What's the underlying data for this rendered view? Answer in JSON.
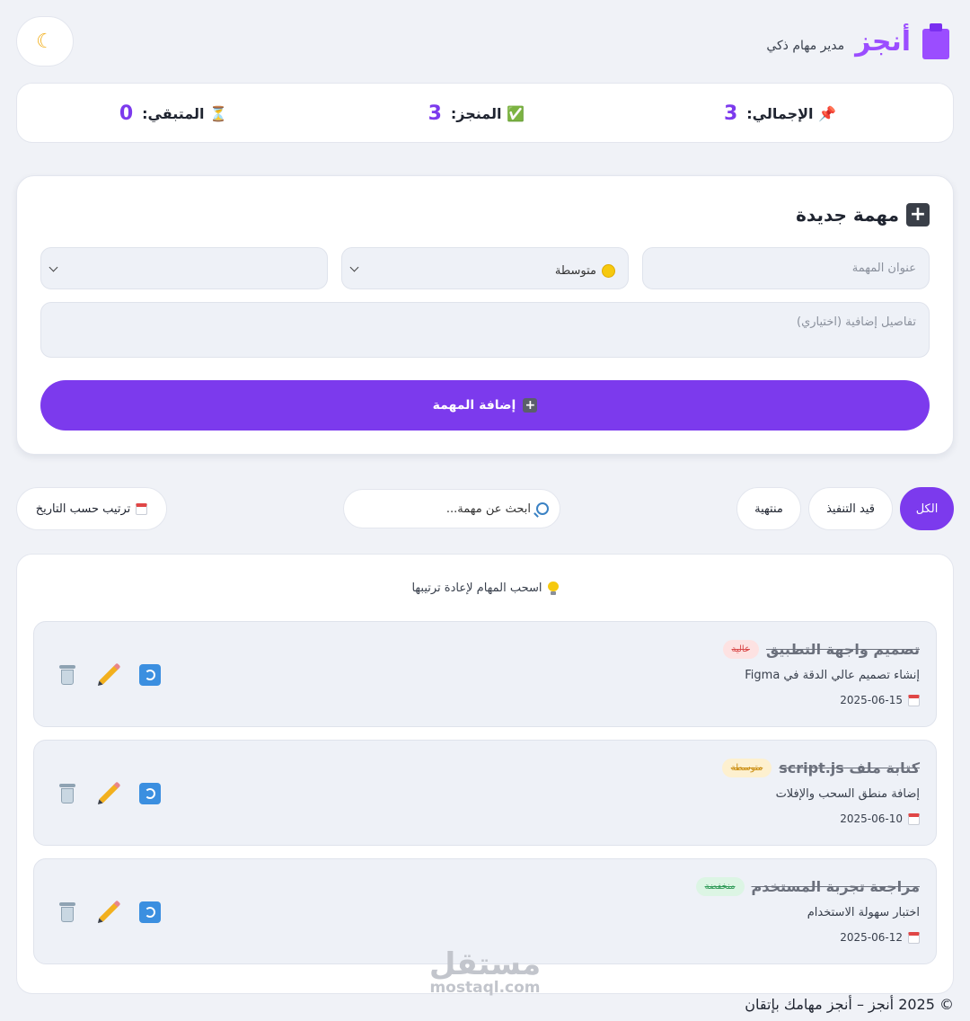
{
  "header": {
    "brand_name": "أنجز",
    "brand_sub": "مدير مهام ذكي",
    "theme_icon": "moon-icon",
    "brand_icon": "clipboard-icon"
  },
  "stats": {
    "total": {
      "label": "📌 الإجمالي:",
      "value": "3"
    },
    "done": {
      "label": "✅ المنجز:",
      "value": "3"
    },
    "remaining": {
      "label": "⏳ المتبقي:",
      "value": "0"
    }
  },
  "form": {
    "title": "مهمة جديدة",
    "title_placeholder": "عنوان المهمة",
    "priority_value": "متوسطة",
    "category_value": "",
    "desc_placeholder": "تفاصيل إضافية (اختياري)",
    "submit_label": "إضافة المهمة"
  },
  "filters": {
    "all": "الكل",
    "in_progress": "قيد التنفيذ",
    "done": "منتهية",
    "search_placeholder": "ابحث عن مهمة...",
    "sort_label": "ترتيب حسب التاريخ",
    "active": "all"
  },
  "list": {
    "hint": "اسحب المهام لإعادة ترتيبها",
    "tasks": [
      {
        "title": "تصميم واجهة التطبيق",
        "priority": "عالية",
        "priority_level": "high",
        "desc": "إنشاء تصميم عالي الدقة في Figma",
        "date": "2025-06-15",
        "done": true
      },
      {
        "title": "كتابة ملف script.js",
        "priority": "متوسطة",
        "priority_level": "mid",
        "desc": "إضافة منطق السحب والإفلات",
        "date": "2025-06-10",
        "done": true
      },
      {
        "title": "مراجعة تجربة المستخدم",
        "priority": "منخفضة",
        "priority_level": "low",
        "desc": "اختبار سهولة الاستخدام",
        "date": "2025-06-12",
        "done": true
      }
    ]
  },
  "watermark": {
    "ar": "مستقل",
    "en": "mostaql.com"
  },
  "footer": {
    "text": "© 2025 أنجز – أنجز مهامك بإتقان"
  },
  "colors": {
    "accent": "#7c3aed",
    "brand": "#9b4dff",
    "background": "#f0f2f7"
  }
}
